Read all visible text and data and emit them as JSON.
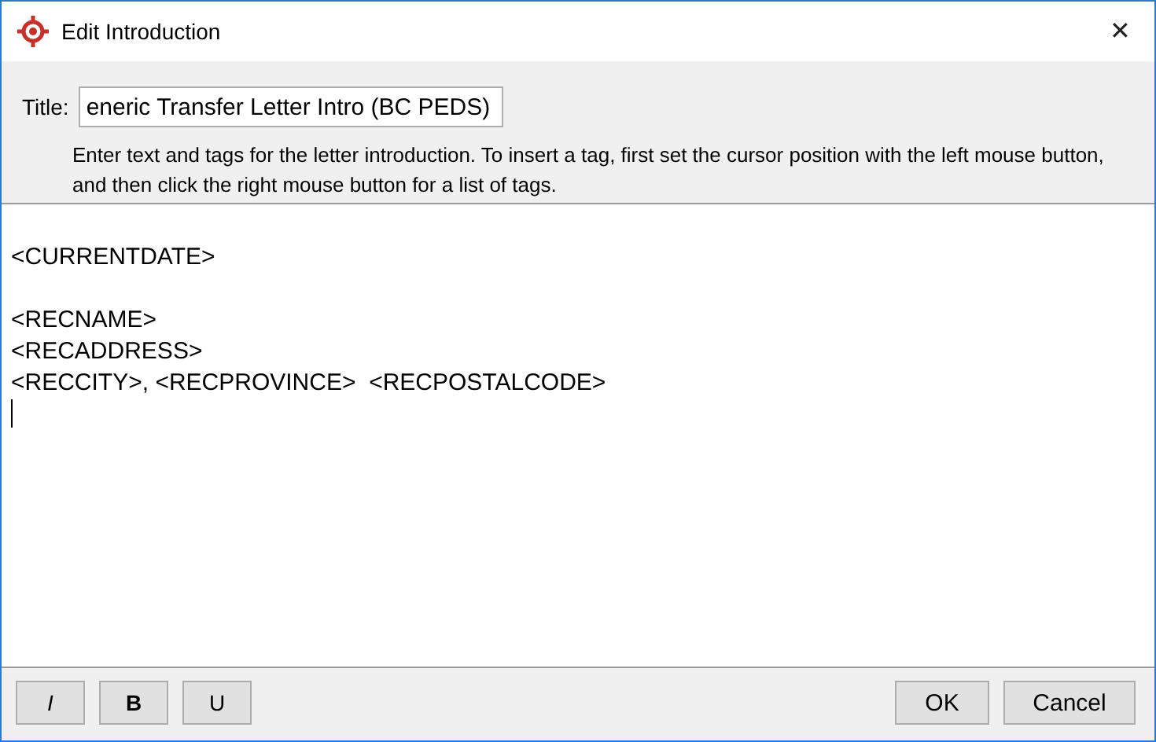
{
  "window": {
    "title": "Edit Introduction",
    "close": "✕"
  },
  "title_field": {
    "label": "Title:",
    "value": "eneric Transfer Letter Intro (BC PEDS)"
  },
  "instructions": "Enter text and tags for the letter introduction. To insert a tag, first set the cursor position with the left mouse button, and then click the right mouse button for a list of tags.",
  "editor": {
    "text": "\n<CURRENTDATE>\n\n<RECNAME>\n<RECADDRESS>\n<RECCITY>, <RECPROVINCE>  <RECPOSTALCODE>\n"
  },
  "format_buttons": [
    {
      "label": "I",
      "kind": "italic"
    },
    {
      "label": "B",
      "kind": "bold"
    },
    {
      "label": "U",
      "kind": "underline"
    }
  ],
  "buttons": [
    "OK",
    "Cancel"
  ]
}
